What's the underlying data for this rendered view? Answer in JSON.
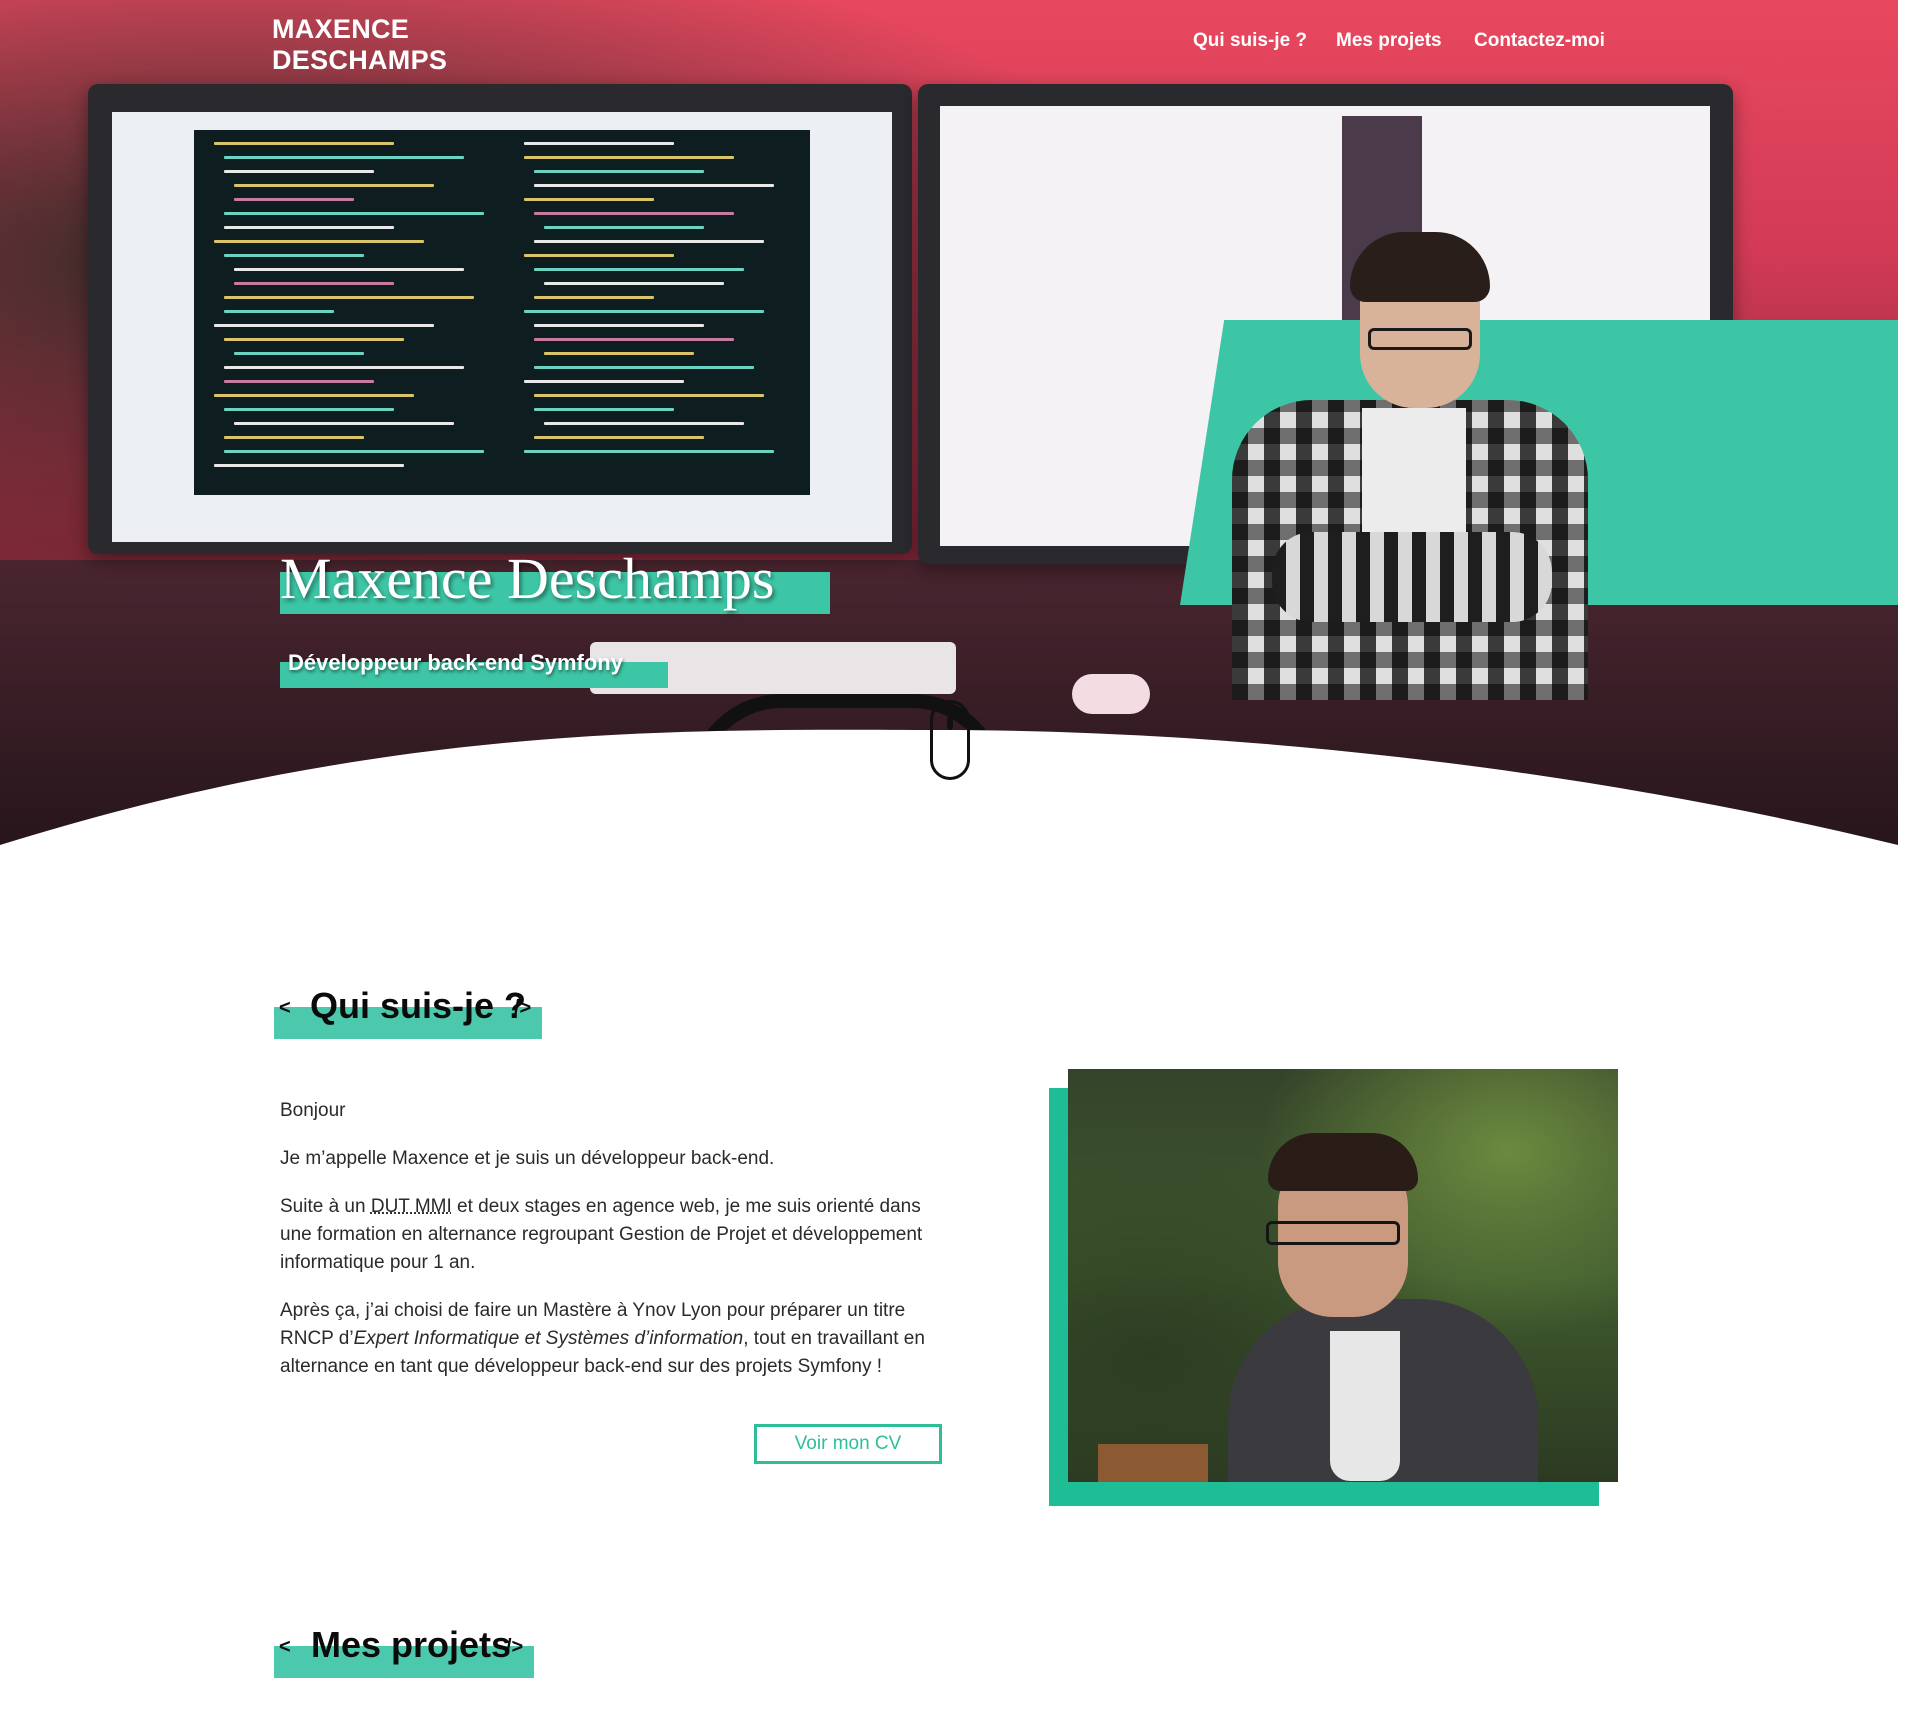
{
  "header": {
    "brand_line1": "MAXENCE",
    "brand_line2": "DESCHAMPS",
    "nav": [
      "Qui suis-je ?",
      "Mes projets",
      "Contactez-moi"
    ]
  },
  "hero": {
    "name": "Maxence Deschamps",
    "role": "Développeur back-end Symfony"
  },
  "about": {
    "title": "Qui suis-je ?",
    "bracket_open": "<",
    "bracket_close": "/>",
    "p1": "Bonjour",
    "p2": "Je m’appelle Maxence et je suis un développeur back-end.",
    "p3_a": "Suite à un ",
    "p3_abbr": "DUT MMI",
    "p3_b": " et deux stages en agence web, je me suis orienté dans une formation en alternance regroupant Gestion de Projet et développement informatique pour 1 an.",
    "p4_a": "Après ça, j’ai choisi de faire un Mastère à Ynov Lyon pour préparer un titre RNCP d’",
    "p4_em": "Expert Informatique et Systèmes d’information",
    "p4_b": ", tout en travaillant en alternance en tant que développeur back-end sur des projets Symfony !",
    "cv_button": "Voir mon CV"
  },
  "projects": {
    "title": "Mes projets",
    "bracket_open": "<",
    "bracket_close": "/>"
  },
  "colors": {
    "accent": "#3dc6a6",
    "accent_dark": "#1fbd96",
    "hero_pink": "#d23a56"
  },
  "icons": [
    "scroll-mouse-icon"
  ]
}
